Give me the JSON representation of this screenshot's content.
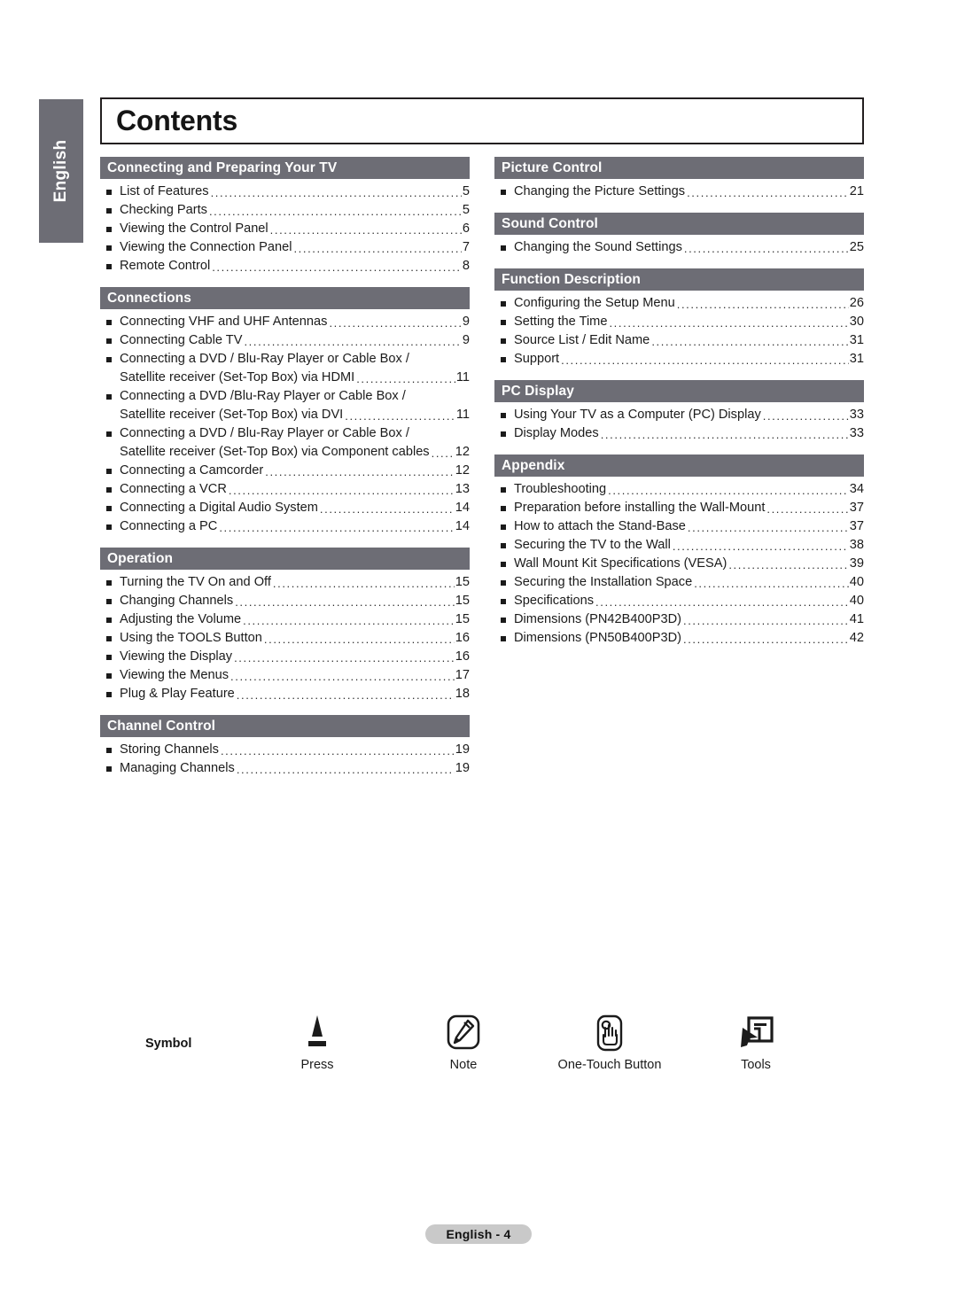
{
  "page": {
    "title": "Contents",
    "side_tab_label": "English",
    "footer_badge": "English - 4",
    "accent_gray": "#6d6d75",
    "badge_gray": "#c9c9c9",
    "text_color": "#1b1b1b"
  },
  "columns": {
    "left": [
      {
        "heading": "Connecting and Preparing Your TV",
        "items": [
          {
            "label": "List of Features",
            "page": "5"
          },
          {
            "label": "Checking Parts",
            "page": "5"
          },
          {
            "label": "Viewing the Control Panel",
            "page": "6"
          },
          {
            "label": "Viewing the Connection Panel",
            "page": "7"
          },
          {
            "label": "Remote Control",
            "page": "8"
          }
        ]
      },
      {
        "heading": "Connections",
        "items": [
          {
            "label": "Connecting VHF and UHF Antennas",
            "page": "9"
          },
          {
            "label": "Connecting Cable TV",
            "page": "9"
          },
          {
            "line1": "Connecting a DVD / Blu-Ray Player or Cable Box /",
            "label": "Satellite receiver (Set-Top Box) via HDMI",
            "page": "11"
          },
          {
            "line1": "Connecting a DVD /Blu-Ray Player or Cable Box /",
            "label": "Satellite receiver (Set-Top Box) via DVI",
            "page": "11"
          },
          {
            "line1": "Connecting a DVD / Blu-Ray Player or Cable Box /",
            "label": "Satellite receiver (Set-Top Box) via Component cables",
            "page": "12"
          },
          {
            "label": "Connecting a Camcorder",
            "page": "12"
          },
          {
            "label": "Connecting a VCR",
            "page": "13"
          },
          {
            "label": "Connecting a Digital Audio System",
            "page": "14"
          },
          {
            "label": "Connecting a PC",
            "page": "14"
          }
        ]
      },
      {
        "heading": "Operation",
        "items": [
          {
            "label": "Turning the TV On and Off",
            "page": "15"
          },
          {
            "label": "Changing Channels",
            "page": "15"
          },
          {
            "label": "Adjusting the Volume",
            "page": "15"
          },
          {
            "label": "Using the TOOLS Button",
            "page": "16"
          },
          {
            "label": "Viewing the Display",
            "page": "16"
          },
          {
            "label": "Viewing the Menus",
            "page": "17"
          },
          {
            "label": "Plug & Play Feature",
            "page": "18"
          }
        ]
      },
      {
        "heading": "Channel Control",
        "items": [
          {
            "label": "Storing Channels",
            "page": "19"
          },
          {
            "label": "Managing Channels",
            "page": "19"
          }
        ]
      }
    ],
    "right": [
      {
        "heading": "Picture Control",
        "items": [
          {
            "label": "Changing the Picture Settings",
            "page": "21"
          }
        ]
      },
      {
        "heading": "Sound Control",
        "items": [
          {
            "label": "Changing the Sound Settings",
            "page": "25"
          }
        ]
      },
      {
        "heading": "Function Description",
        "items": [
          {
            "label": "Configuring the Setup Menu",
            "page": "26"
          },
          {
            "label": "Setting the Time",
            "page": "30"
          },
          {
            "label": "Source List / Edit Name",
            "page": "31"
          },
          {
            "label": "Support",
            "page": "31"
          }
        ]
      },
      {
        "heading": "PC Display",
        "items": [
          {
            "label": "Using Your TV as a Computer (PC) Display",
            "page": "33"
          },
          {
            "label": "Display Modes",
            "page": "33"
          }
        ]
      },
      {
        "heading": "Appendix",
        "items": [
          {
            "label": "Troubleshooting",
            "page": "34"
          },
          {
            "label": "Preparation before installing the Wall-Mount",
            "page": "37"
          },
          {
            "label": "How to attach the Stand-Base",
            "page": "37"
          },
          {
            "label": "Securing the TV to the Wall",
            "page": "38"
          },
          {
            "label": "Wall Mount Kit Specifications (VESA)",
            "page": "39"
          },
          {
            "label": "Securing the Installation Space",
            "page": "40"
          },
          {
            "label": "Specifications",
            "page": "40"
          },
          {
            "label": "Dimensions (PN42B400P3D)",
            "page": "41"
          },
          {
            "label": "Dimensions (PN50B400P3D)",
            "page": "42"
          }
        ]
      }
    ]
  },
  "legend": {
    "title": "Symbol",
    "items": [
      {
        "icon": "press-triangle-icon",
        "caption": "Press"
      },
      {
        "icon": "note-pencil-icon",
        "caption": "Note"
      },
      {
        "icon": "one-touch-button-icon",
        "caption": "One-Touch Button"
      },
      {
        "icon": "tools-cursor-icon",
        "caption": "Tools"
      }
    ]
  }
}
